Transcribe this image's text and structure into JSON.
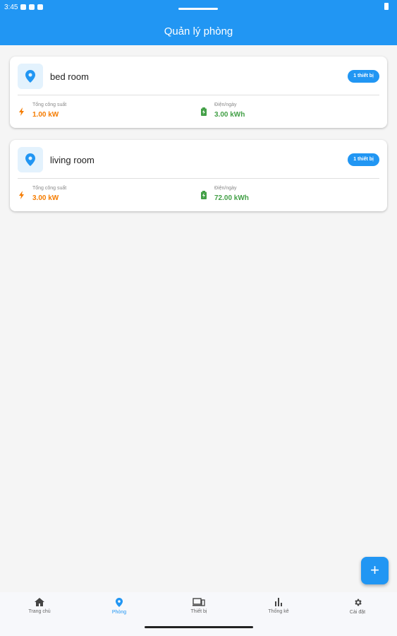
{
  "status_bar": {
    "time": "3:45"
  },
  "header": {
    "title": "Quản lý phòng"
  },
  "rooms": [
    {
      "name": "bed room",
      "badge": "1 thiết bị",
      "power_label": "Tổng công suất",
      "power_value": "1.00 kW",
      "energy_label": "Điện/ngày",
      "energy_value": "3.00 kWh"
    },
    {
      "name": "living room",
      "badge": "1 thiết bị",
      "power_label": "Tổng công suất",
      "power_value": "3.00 kW",
      "energy_label": "Điện/ngày",
      "energy_value": "72.00 kWh"
    }
  ],
  "fab": {
    "label": "+"
  },
  "bottom_nav": {
    "items": [
      {
        "label": "Trang chủ",
        "icon": "home-icon"
      },
      {
        "label": "Phòng",
        "icon": "location-pin-icon",
        "active": true
      },
      {
        "label": "Thiết bị",
        "icon": "devices-icon"
      },
      {
        "label": "Thống kê",
        "icon": "bar-chart-icon"
      },
      {
        "label": "Cài đặt",
        "icon": "gear-icon"
      }
    ]
  },
  "colors": {
    "primary": "#2196f3",
    "power": "#f57c00",
    "energy": "#43a047"
  }
}
